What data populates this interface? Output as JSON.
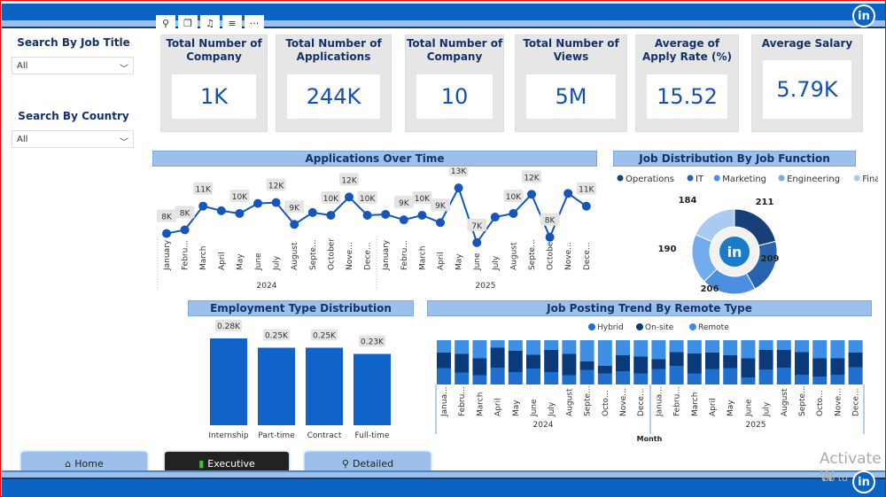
{
  "header": {
    "logo": "in"
  },
  "toolbar": {
    "icons": [
      "pin-icon",
      "copy-icon",
      "bell-icon",
      "filter-icon",
      "more-icon"
    ],
    "glyphs": [
      "⚲",
      "❐",
      "♫",
      "≡",
      "···"
    ]
  },
  "filters": [
    {
      "label": "Search By Job Title",
      "value": "All"
    },
    {
      "label": "Search By Country",
      "value": "All"
    }
  ],
  "kpis": [
    {
      "title": "Total Number of Company",
      "value": "1K"
    },
    {
      "title": "Total Number of Applications",
      "value": "244K"
    },
    {
      "title": "Total Number of Company",
      "value": "10"
    },
    {
      "title": "Total Number of Views",
      "value": "5M"
    },
    {
      "title": "Average of Apply Rate (%)",
      "value": "15.52"
    },
    {
      "title": "Average Salary",
      "value": "5.79K"
    }
  ],
  "colors": {
    "accent": "#0b63c3",
    "line": "#1456bd",
    "hybrid": "#1e6fd0",
    "onsite": "#0a3a7a",
    "remote": "#3d8fe6"
  },
  "chart_data": [
    {
      "type": "line",
      "title": "Applications Over Time",
      "years": [
        "2024",
        "2025"
      ],
      "categories": [
        "January",
        "Febru...",
        "March",
        "April",
        "May",
        "June",
        "July",
        "August",
        "Septe...",
        "October",
        "Nove...",
        "Dece...",
        "January",
        "Febru...",
        "March",
        "April",
        "May",
        "June",
        "July",
        "August",
        "Septe...",
        "October",
        "Nove...",
        "Dece..."
      ],
      "values": [
        8,
        8.4,
        11,
        10.5,
        10.2,
        11.3,
        11.4,
        9,
        10.3,
        10,
        12,
        10,
        10.1,
        9.5,
        10,
        9.2,
        13,
        7,
        9.8,
        10.2,
        12.3,
        7.6,
        12.4,
        11
      ],
      "labels": [
        "8K",
        "8K",
        "11K",
        null,
        "10K",
        null,
        "12K",
        "9K",
        null,
        "10K",
        "12K",
        "10K",
        null,
        "9K",
        "10K",
        "9K",
        "13K",
        "7K",
        null,
        "10K",
        "12K",
        "8K",
        null,
        "11K"
      ],
      "unit": "thousands"
    },
    {
      "type": "pie",
      "title": "Job Distribution By Job Function",
      "labels": [
        "Operations",
        "IT",
        "Marketing",
        "Engineering",
        "Finance"
      ],
      "values": [
        211,
        209,
        206,
        190,
        184
      ],
      "colors": [
        "#173f78",
        "#2864ae",
        "#4a8fe0",
        "#72acec",
        "#a9cbf2"
      ]
    },
    {
      "type": "bar",
      "title": "Employment Type Distribution",
      "categories": [
        "Internship",
        "Part-time",
        "Contract",
        "Full-time"
      ],
      "values": [
        0.28,
        0.25,
        0.25,
        0.23
      ],
      "labels": [
        "0.28K",
        "0.25K",
        "0.25K",
        "0.23K"
      ]
    },
    {
      "type": "bar",
      "stacked": true,
      "title": "Job Posting Trend By Remote Type",
      "xlabel": "Month",
      "years": [
        "2024",
        "2025"
      ],
      "categories": [
        "Janua...",
        "Febru...",
        "March",
        "April",
        "May",
        "June",
        "July",
        "August",
        "Septe...",
        "Octo...",
        "Nove...",
        "Dece...",
        "Janua...",
        "Febru...",
        "March",
        "April",
        "May",
        "June",
        "July",
        "August",
        "Septe...",
        "Octo...",
        "Nove...",
        "Dece..."
      ],
      "series": [
        {
          "name": "Hybrid",
          "values": [
            0.37,
            0.27,
            0.21,
            0.38,
            0.28,
            0.36,
            0.28,
            0.21,
            0.33,
            0.25,
            0.3,
            0.25,
            0.35,
            0.42,
            0.25,
            0.35,
            0.37,
            0.16,
            0.34,
            0.38,
            0.22,
            0.18,
            0.22,
            0.39
          ]
        },
        {
          "name": "On-site",
          "values": [
            0.35,
            0.42,
            0.38,
            0.45,
            0.48,
            0.31,
            0.5,
            0.48,
            0.19,
            0.17,
            0.36,
            0.38,
            0.22,
            0.31,
            0.45,
            0.37,
            0.29,
            0.43,
            0.44,
            0.4,
            0.51,
            0.41,
            0.37,
            0.33
          ]
        },
        {
          "name": "Remote",
          "values": [
            0.28,
            0.31,
            0.41,
            0.17,
            0.24,
            0.33,
            0.22,
            0.31,
            0.48,
            0.58,
            0.34,
            0.37,
            0.43,
            0.27,
            0.3,
            0.28,
            0.34,
            0.41,
            0.22,
            0.22,
            0.27,
            0.41,
            0.41,
            0.28
          ]
        }
      ],
      "unit": "share"
    }
  ],
  "nav": [
    {
      "label": "Home",
      "icon": "⌂"
    },
    {
      "label": "Executive",
      "icon": "▮"
    },
    {
      "label": "Detailed",
      "icon": "⚲"
    }
  ],
  "watermark": {
    "line1": "Activate W",
    "line2": "Go to"
  }
}
